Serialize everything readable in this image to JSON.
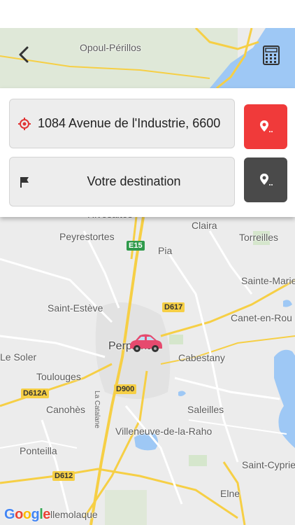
{
  "colors": {
    "origin_button": "#f03a3a",
    "destination_button": "#4a4a4a",
    "field_background": "#ededed",
    "water": "#9ec8f5",
    "highway": "#f6cf45",
    "car": "#e64a6e"
  },
  "nav": {
    "back_icon": "chevron-left-icon",
    "calculator_icon": "calculator-icon"
  },
  "route": {
    "origin": {
      "value": "1084 Avenue de l'Industrie, 6600",
      "icon": "crosshair-location-icon",
      "button_icon": "map-pin-icon"
    },
    "destination": {
      "placeholder": "Votre destination",
      "icon": "flag-icon",
      "button_icon": "map-pin-icon"
    }
  },
  "map": {
    "places": {
      "opoul": "Opoul-Périllos",
      "rivesaltes": "Rivesaltes",
      "claira": "Claira",
      "peyrestortes": "Peyrestortes",
      "torreilles": "Torreilles",
      "pia": "Pia",
      "sainte_marie": "Sainte-Marie",
      "saint_esteve": "Saint-Estève",
      "canet": "Canet-en-Rou",
      "perpignan": "Perpignan",
      "le_soler": "Le Soler",
      "cabestany": "Cabestany",
      "toulouges": "Toulouges",
      "canohes": "Canohès",
      "saleilles": "Saleilles",
      "villeneuve": "Villeneuve-de-la-Raho",
      "ponteilla": "Ponteilla",
      "saint_cyprien": "Saint-Cyprie",
      "elne": "Elne",
      "bellemolaque": "llemolaque"
    },
    "roads": {
      "e15": "E15",
      "d617": "D617",
      "d612a": "D612A",
      "d900": "D900",
      "d612": "D612",
      "la_catalane": "La Catalane"
    },
    "attribution": {
      "g": "G",
      "o1": "o",
      "o2": "o",
      "g2": "g",
      "l": "l",
      "e": "e"
    },
    "car_icon": "car-marker-icon"
  }
}
